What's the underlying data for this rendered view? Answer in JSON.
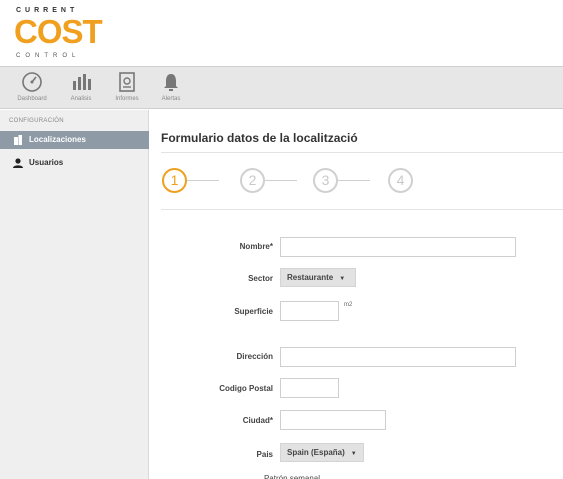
{
  "brand": {
    "top": "CURRENT",
    "main": "COST",
    "bottom": "CONTROL"
  },
  "toolbar": {
    "items": [
      {
        "label": "Dashboard",
        "icon": "gauge-icon"
      },
      {
        "label": "Analisis",
        "icon": "bar-chart-icon"
      },
      {
        "label": "Informes",
        "icon": "report-icon"
      },
      {
        "label": "Alertas",
        "icon": "bell-icon"
      }
    ]
  },
  "sidebar": {
    "heading": "CONFIGURACIÓN",
    "items": [
      {
        "label": "Localizaciones",
        "icon": "building-icon",
        "active": true
      },
      {
        "label": "Usuarios",
        "icon": "user-icon",
        "active": false
      }
    ]
  },
  "form": {
    "title": "Formulario datos de la localització",
    "steps": [
      "1",
      "2",
      "3",
      "4"
    ],
    "active_step": 1,
    "fields": {
      "nombre_label": "Nombre*",
      "nombre_value": "",
      "sector_label": "Sector",
      "sector_value": "Restaurante",
      "superficie_label": "Superficie",
      "superficie_value": "",
      "superficie_unit": "m2",
      "direccion_label": "Dirección",
      "direccion_value": "",
      "codigo_postal_label": "Codigo Postal",
      "codigo_postal_value": "",
      "ciudad_label": "Ciudad*",
      "ciudad_value": "",
      "pais_label": "Pais",
      "pais_value": "Spain (España)",
      "next_label": "Patrón semanal"
    }
  },
  "colors": {
    "accent": "#f0a01e",
    "sidebar_active": "#8e9aa6",
    "toolbar_bg": "#e7e7e7"
  }
}
